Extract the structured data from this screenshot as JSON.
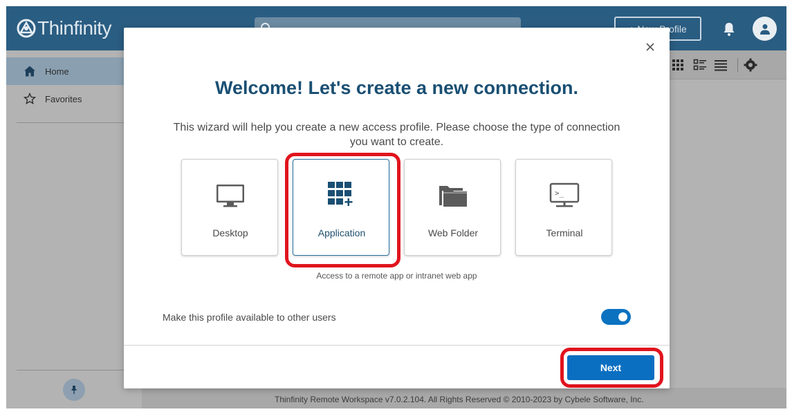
{
  "app": {
    "brand": "Thinfinity",
    "new_profile_label": "+ New Profile",
    "search": {
      "placeholder": ""
    }
  },
  "sidebar": {
    "items": [
      {
        "label": "Home",
        "icon": "home-icon",
        "active": true
      },
      {
        "label": "Favorites",
        "icon": "star-icon",
        "active": false
      }
    ]
  },
  "toolbar": {
    "views": [
      "grid-view-icon",
      "list-detail-view-icon",
      "list-view-icon",
      "settings-icon"
    ]
  },
  "modal": {
    "title": "Welcome! Let's create a new connection.",
    "description": "This wizard will help you create a new access profile. Please choose the type of connection you want to create.",
    "connection_types": [
      {
        "label": "Desktop",
        "icon": "monitor-icon",
        "selected": false
      },
      {
        "label": "Application",
        "icon": "apps-grid-plus-icon",
        "selected": true
      },
      {
        "label": "Web Folder",
        "icon": "folder-icon",
        "selected": false
      },
      {
        "label": "Terminal",
        "icon": "terminal-icon",
        "selected": false
      }
    ],
    "selected_hint": "Access to a remote app or intranet web app",
    "share_label": "Make this profile available to other users",
    "share_enabled": true,
    "next_label": "Next"
  },
  "footer": {
    "text": "Thinfinity Remote Workspace v7.0.2.104. All Rights Reserved © 2010-2023 by Cybele Software, Inc."
  },
  "colors": {
    "topbar": "#2a5d82",
    "title": "#1a4f73",
    "accent": "#0b6fc1",
    "annotation": "#e0141e"
  }
}
